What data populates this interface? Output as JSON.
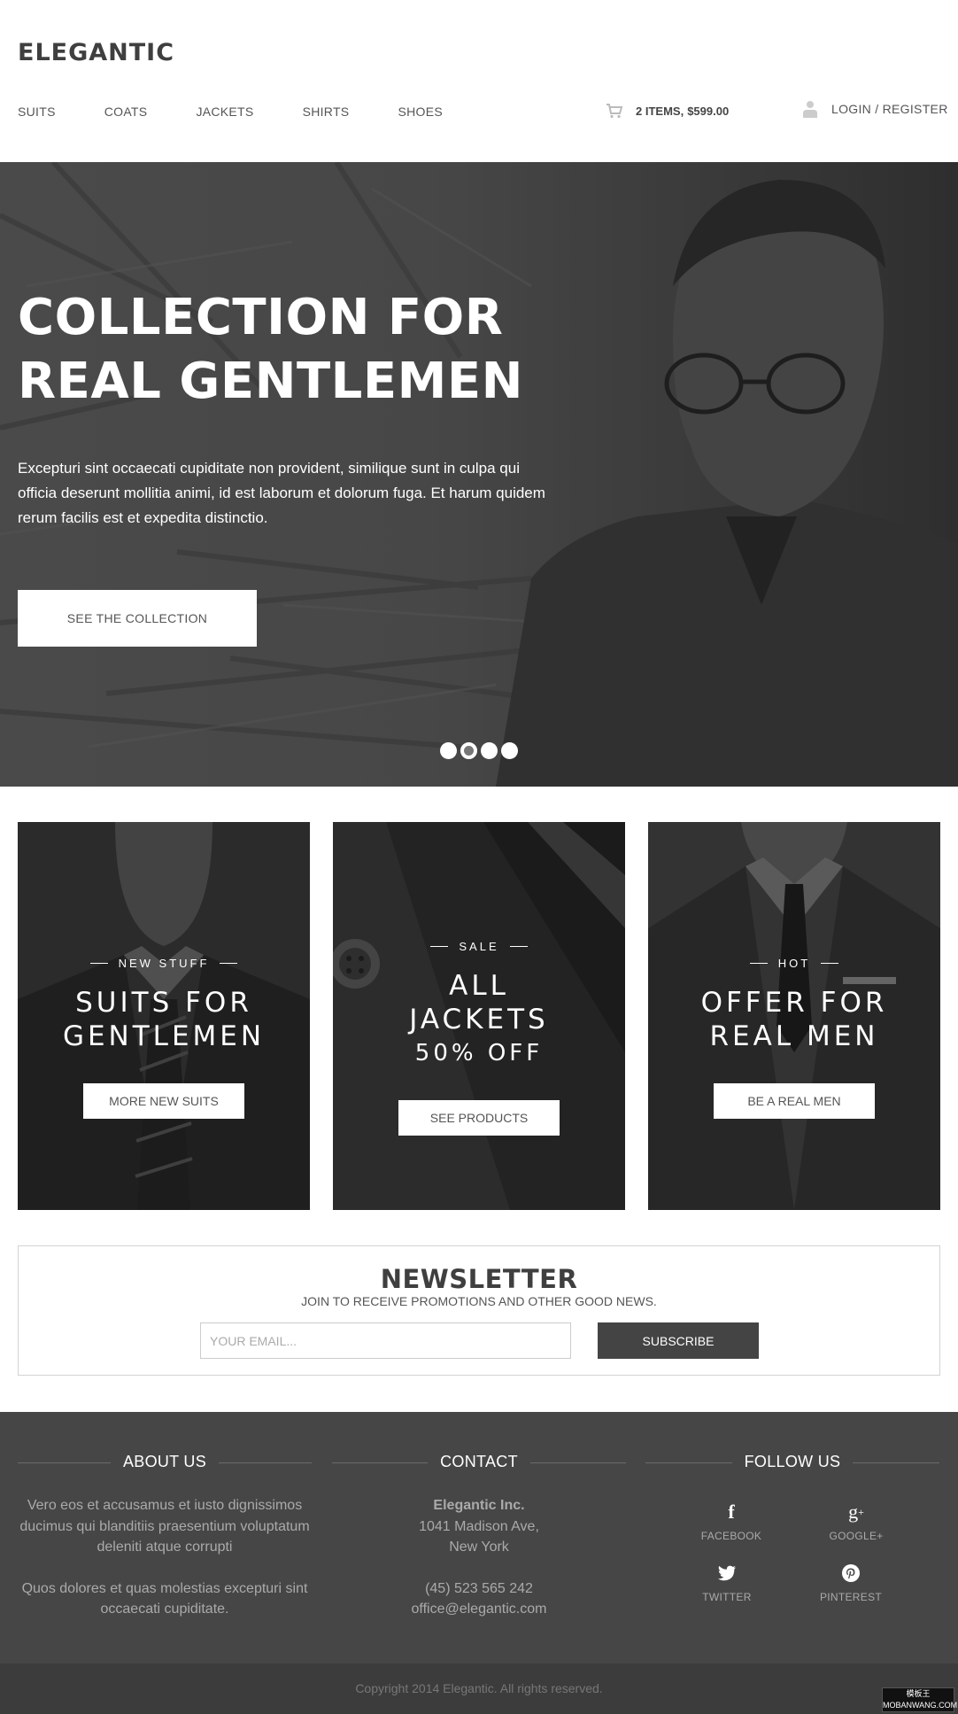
{
  "header": {
    "logo": "ELEGANTIC",
    "nav": [
      "SUITS",
      "COATS",
      "JACKETS",
      "SHIRTS",
      "SHOES"
    ],
    "cart_items": "2 ITEMS,",
    "cart_price": "$599.00",
    "login": "LOGIN / REGISTER"
  },
  "hero": {
    "title_line1": "COLLECTION FOR",
    "title_line2": "REAL GENTLEMEN",
    "text": "Excepturi sint occaecati cupiditate non provident, similique sunt in culpa qui officia deserunt mollitia animi, id est laborum et dolorum fuga. Et harum quidem rerum facilis est et expedita distinctio.",
    "button": "SEE THE COLLECTION",
    "slides": 4,
    "active_slide": 2
  },
  "cards": [
    {
      "tag": "NEW STUFF",
      "title_line1": "SUITS FOR",
      "title_line2": "GENTLEMEN",
      "button": "MORE NEW SUITS"
    },
    {
      "tag": "SALE",
      "title_line1": "ALL",
      "title_line2": "JACKETS",
      "title_line3": "50% OFF",
      "button": "SEE PRODUCTS"
    },
    {
      "tag": "HOT",
      "title_line1": "OFFER FOR",
      "title_line2": "REAL MEN",
      "button": "BE A REAL MEN"
    }
  ],
  "newsletter": {
    "title": "NEWSLETTER",
    "subtitle": "JOIN TO RECEIVE PROMOTIONS AND OTHER GOOD NEWS.",
    "placeholder": "YOUR EMAIL...",
    "button": "SUBSCRIBE"
  },
  "footer": {
    "about": {
      "heading": "ABOUT US",
      "p1": "Vero eos et accusamus et iusto dignissimos ducimus qui blanditiis praesentium voluptatum deleniti atque corrupti",
      "p2": "Quos dolores et quas molestias excepturi sint occaecati cupiditate."
    },
    "contact": {
      "heading": "CONTACT",
      "company": "Elegantic Inc.",
      "address1": "1041 Madison Ave,",
      "address2": "New York",
      "phone": "(45) 523 565 242",
      "email": "office@elegantic.com"
    },
    "follow": {
      "heading": "FOLLOW US",
      "facebook": "FACEBOOK",
      "google": "GOOGLE+",
      "twitter": "TWITTER",
      "pinterest": "PINTEREST"
    },
    "copyright": "Copyright 2014 Elegantic. All rights reserved."
  },
  "watermark": {
    "line1": "模板王",
    "line2": "MOBANWANG.COM"
  },
  "colors": {
    "dark": "#464646",
    "footer_bottom": "#3c3c3c",
    "accent_button": "#444444"
  }
}
